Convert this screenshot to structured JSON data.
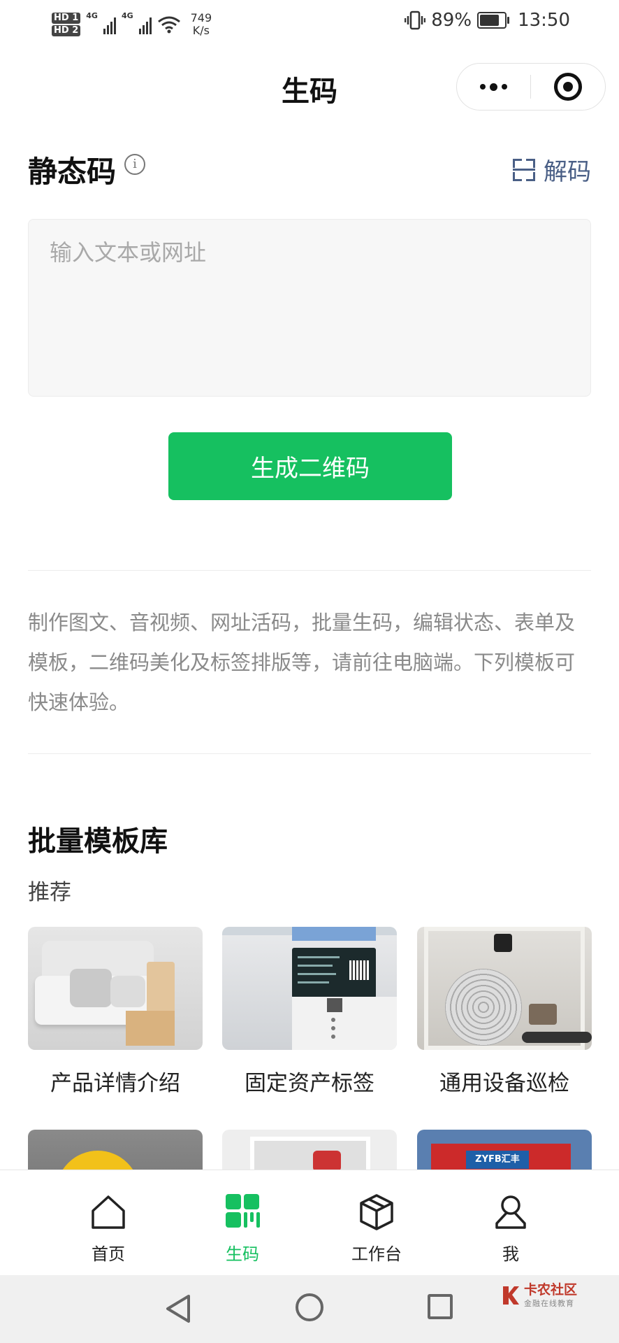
{
  "status_bar": {
    "sim1": "HD 1",
    "sim2": "HD 2",
    "net_speed_value": "749",
    "net_speed_unit": "K/s",
    "battery": "89%",
    "battery_level": 0.89,
    "time": "13:50"
  },
  "nav": {
    "title": "生码"
  },
  "static_code": {
    "title": "静态码",
    "decode_label": "解码",
    "input_placeholder": "输入文本或网址",
    "generate_button": "生成二维码"
  },
  "description": "制作图文、音视频、网址活码，批量生码，编辑状态、表单及模板，二维码美化及标签排版等，请前往电脑端。下列模板可快速体验。",
  "template_library": {
    "title": "批量模板库",
    "subtitle": "推荐",
    "templates": [
      {
        "label": "产品详情介绍",
        "image": "sofa-photo"
      },
      {
        "label": "固定资产标签",
        "image": "air-conditioner-photo"
      },
      {
        "label": "通用设备巡检",
        "image": "fire-hose-photo"
      }
    ],
    "partial_row": [
      {
        "image": "helmet-photo"
      },
      {
        "image": "cabinet-photo"
      },
      {
        "image": "red-box-photo",
        "tag": "ZYFB汇丰"
      }
    ]
  },
  "tabbar": {
    "items": [
      {
        "label": "首页",
        "icon": "home-icon",
        "active": false
      },
      {
        "label": "生码",
        "icon": "qr-code-icon",
        "active": true
      },
      {
        "label": "工作台",
        "icon": "box-icon",
        "active": false
      },
      {
        "label": "我",
        "icon": "user-icon",
        "active": false
      }
    ],
    "active_color": "#16c060"
  },
  "watermark": {
    "name": "卡农社区",
    "tagline": "金融在线教育"
  },
  "colors": {
    "primary": "#16c060",
    "link": "#4a5f86"
  }
}
